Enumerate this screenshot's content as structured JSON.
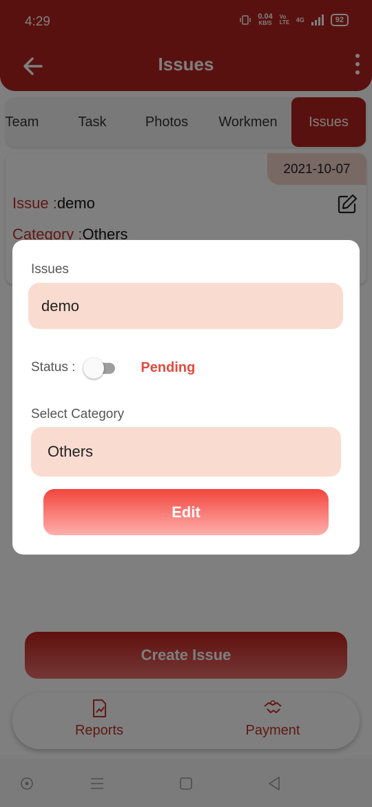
{
  "status_bar": {
    "time": "4:29",
    "speed_value": "0.04",
    "speed_unit": "KB/S",
    "volte": "Vo LTE",
    "network": "4G",
    "battery": "92"
  },
  "app_bar": {
    "title": "Issues",
    "back_icon": "arrow-left-icon",
    "menu_icon": "more-vert-icon"
  },
  "tabs": [
    {
      "label": "Team",
      "active": false
    },
    {
      "label": "Task",
      "active": false
    },
    {
      "label": "Photos",
      "active": false
    },
    {
      "label": "Workmen",
      "active": false
    },
    {
      "label": "Issues",
      "active": true
    }
  ],
  "issue_card": {
    "date": "2021-10-07",
    "issue_label": "Issue :",
    "issue_value": "demo",
    "category_label": "Category :",
    "category_value": "Others",
    "edit_icon": "edit-square-icon"
  },
  "dialog": {
    "issues_label": "Issues",
    "issues_value": "demo",
    "status_label": "Status :",
    "status_toggle_on": false,
    "status_value": "Pending",
    "category_label": "Select Category",
    "category_value": "Others",
    "edit_button": "Edit"
  },
  "create_button": "Create Issue",
  "bottom_nav": [
    {
      "label": "Reports",
      "icon": "report-chart-icon"
    },
    {
      "label": "Payment",
      "icon": "payment-handshake-icon"
    }
  ],
  "system_nav": [
    "recent-dot-icon",
    "menu-lines-icon",
    "home-square-icon",
    "back-triangle-icon"
  ],
  "colors": {
    "primary": "#b3221f",
    "accent_red": "#e24a3b",
    "field_bg": "#f9dbd0",
    "date_bg": "#f3d2c8"
  }
}
